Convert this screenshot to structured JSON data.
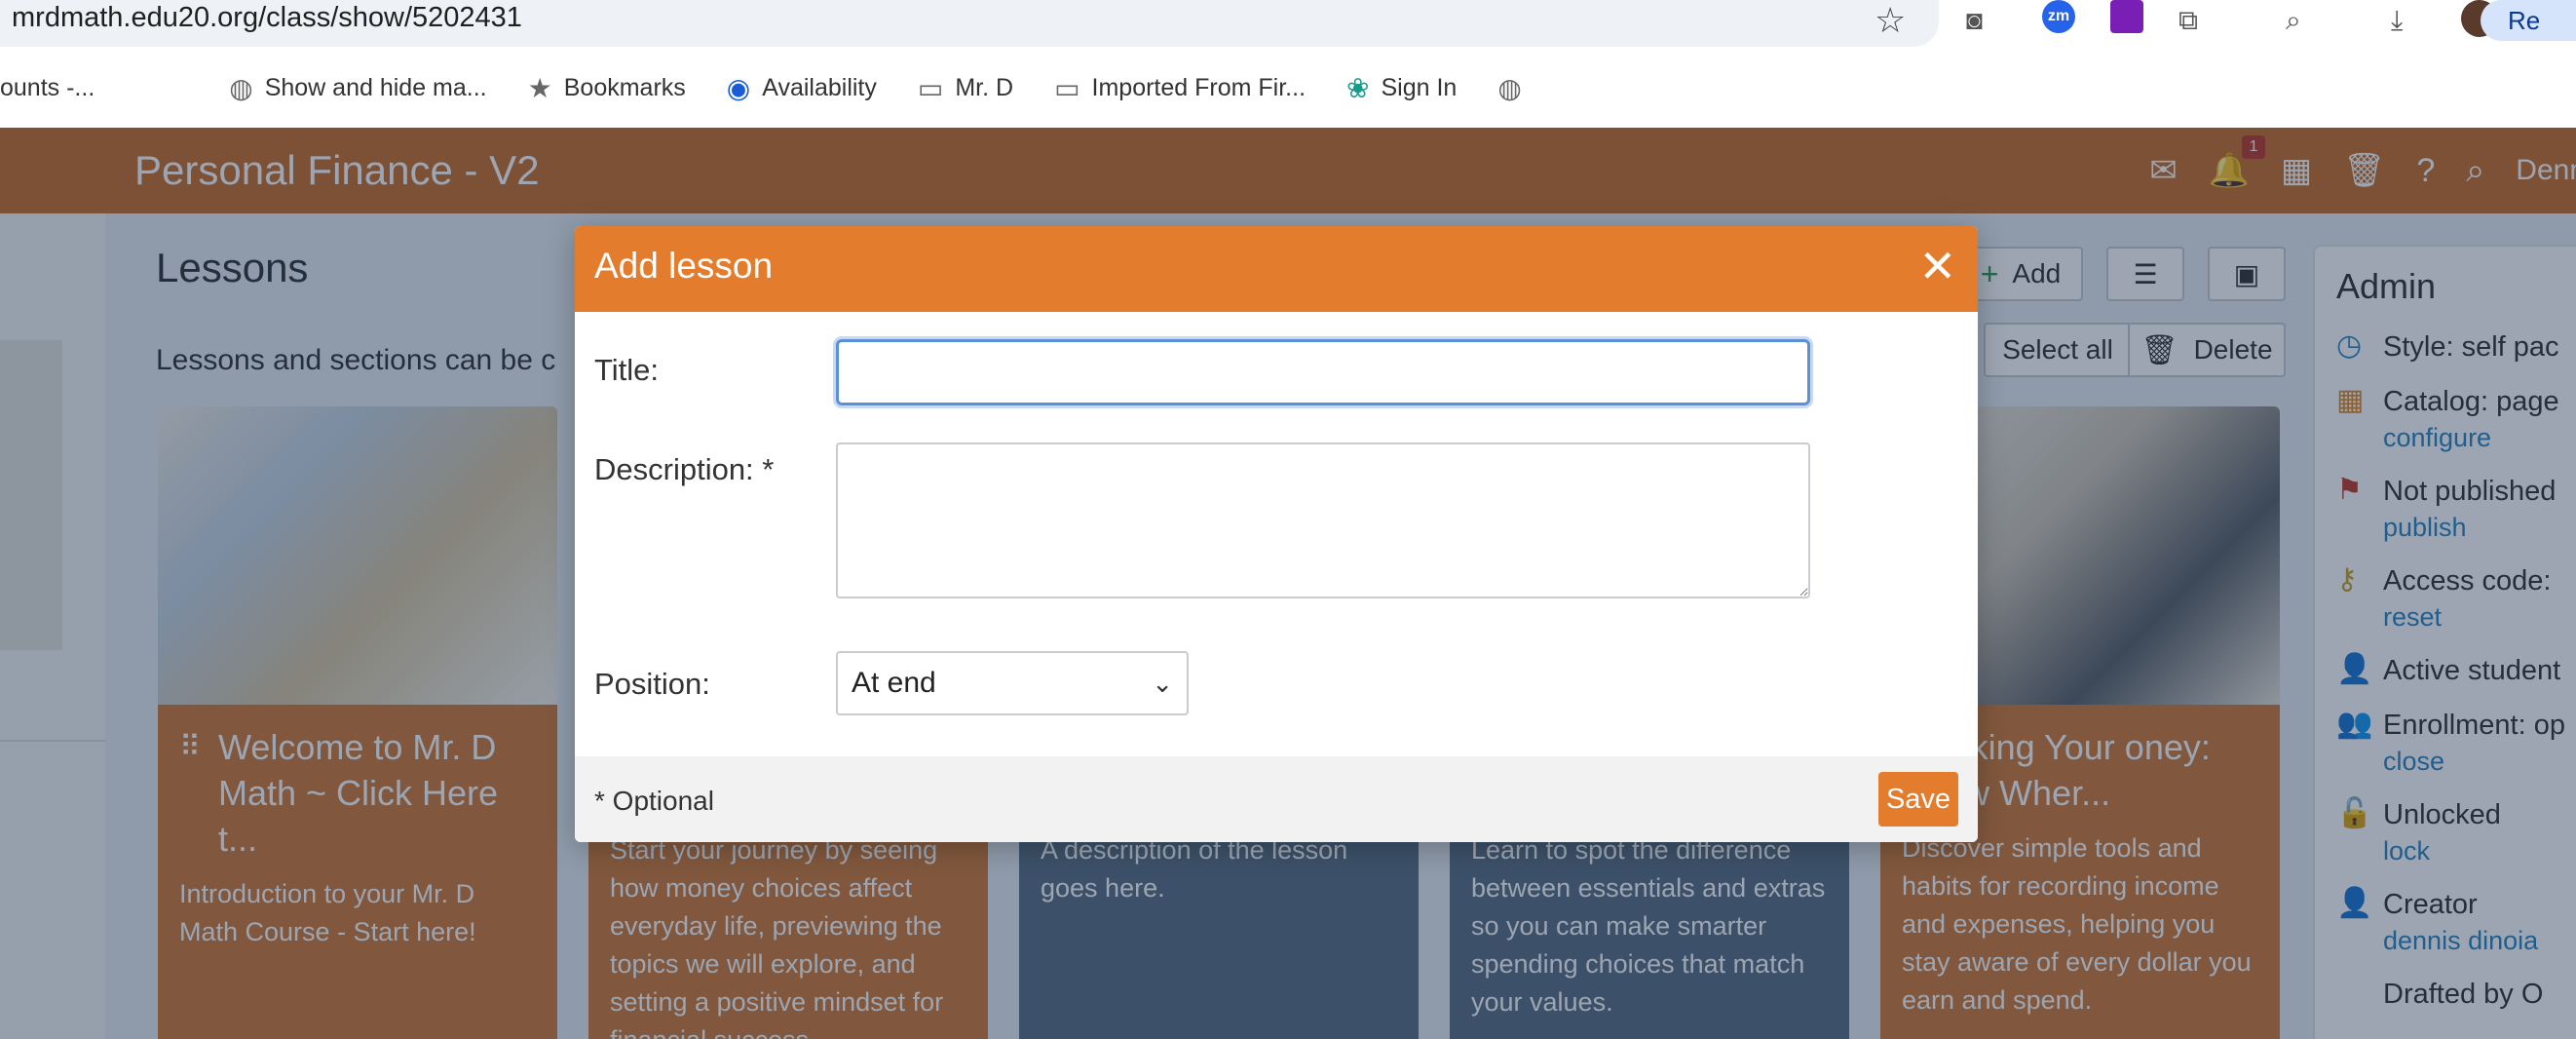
{
  "browser": {
    "url": "mrdmath.edu20.org/class/show/5202431",
    "zoom_ext_label": "zm",
    "profile_label": "Re",
    "bookmarks": [
      {
        "label": "ounts -...",
        "icon": "none"
      },
      {
        "label": "Show and hide ma...",
        "icon": "globe-icon"
      },
      {
        "label": "Bookmarks",
        "icon": "star-icon"
      },
      {
        "label": "Availability",
        "icon": "calendly-icon"
      },
      {
        "label": "Mr. D",
        "icon": "folder-icon"
      },
      {
        "label": "Imported From Fir...",
        "icon": "folder-icon"
      },
      {
        "label": "Sign In",
        "icon": "swirl-icon"
      },
      {
        "label": "",
        "icon": "globe-icon"
      }
    ]
  },
  "app": {
    "title": "Personal Finance - V2",
    "notification_count": "1",
    "user_name": "Denn",
    "lessons_heading": "Lessons",
    "lessons_subtitle": "Lessons and sections can be c",
    "toolbar": {
      "add_label": "Add",
      "select_all_label": "Select all",
      "delete_label": "Delete"
    },
    "cards": [
      {
        "title": "Welcome to Mr. D Math ~ Click Here t...",
        "description": "Introduction to your Mr. D Math Course - Start here!"
      },
      {
        "title": "",
        "description": "Start your journey by seeing how money choices affect everyday life, previewing the topics we will explore, and setting a positive mindset for financial success."
      },
      {
        "title": "",
        "description": "A description of the lesson goes here."
      },
      {
        "title": "",
        "description": "Learn to spot the difference between essentials and extras so you can make smarter spending choices that match your values."
      },
      {
        "title": "Tracking Your oney: Know Wher...",
        "description": "Discover simple tools and habits for recording income and expenses, helping you stay aware of every dollar you earn and spend."
      }
    ],
    "admin": {
      "title": "Admin",
      "rows": [
        {
          "icon": "clock-icon",
          "main": "Style: self pac",
          "link": ""
        },
        {
          "icon": "catalog-icon",
          "main": "Catalog: page",
          "link": "configure"
        },
        {
          "icon": "flag-icon",
          "main": "Not published",
          "link": "publish"
        },
        {
          "icon": "key-icon",
          "main": "Access code:",
          "link": "reset"
        },
        {
          "icon": "person-icon",
          "main": "Active student",
          "link": ""
        },
        {
          "icon": "group-icon",
          "main": "Enrollment: op",
          "link": "close"
        },
        {
          "icon": "unlock-icon",
          "main": "Unlocked",
          "link": "lock"
        },
        {
          "icon": "person-icon",
          "main": "Creator",
          "link": "dennis dinoia"
        },
        {
          "icon": "",
          "main": "Drafted by O",
          "link": ""
        }
      ]
    }
  },
  "modal": {
    "title": "Add lesson",
    "title_label": "Title:",
    "title_value": "",
    "description_label": "Description: *",
    "description_value": "",
    "position_label": "Position:",
    "position_value": "At end",
    "optional_note": "* Optional",
    "save_label": "Save"
  },
  "colors": {
    "accent_orange": "#e37d2d",
    "card_orange": "#d17a38",
    "card_slate": "#5a6f84",
    "link_blue": "#2e86c1"
  }
}
